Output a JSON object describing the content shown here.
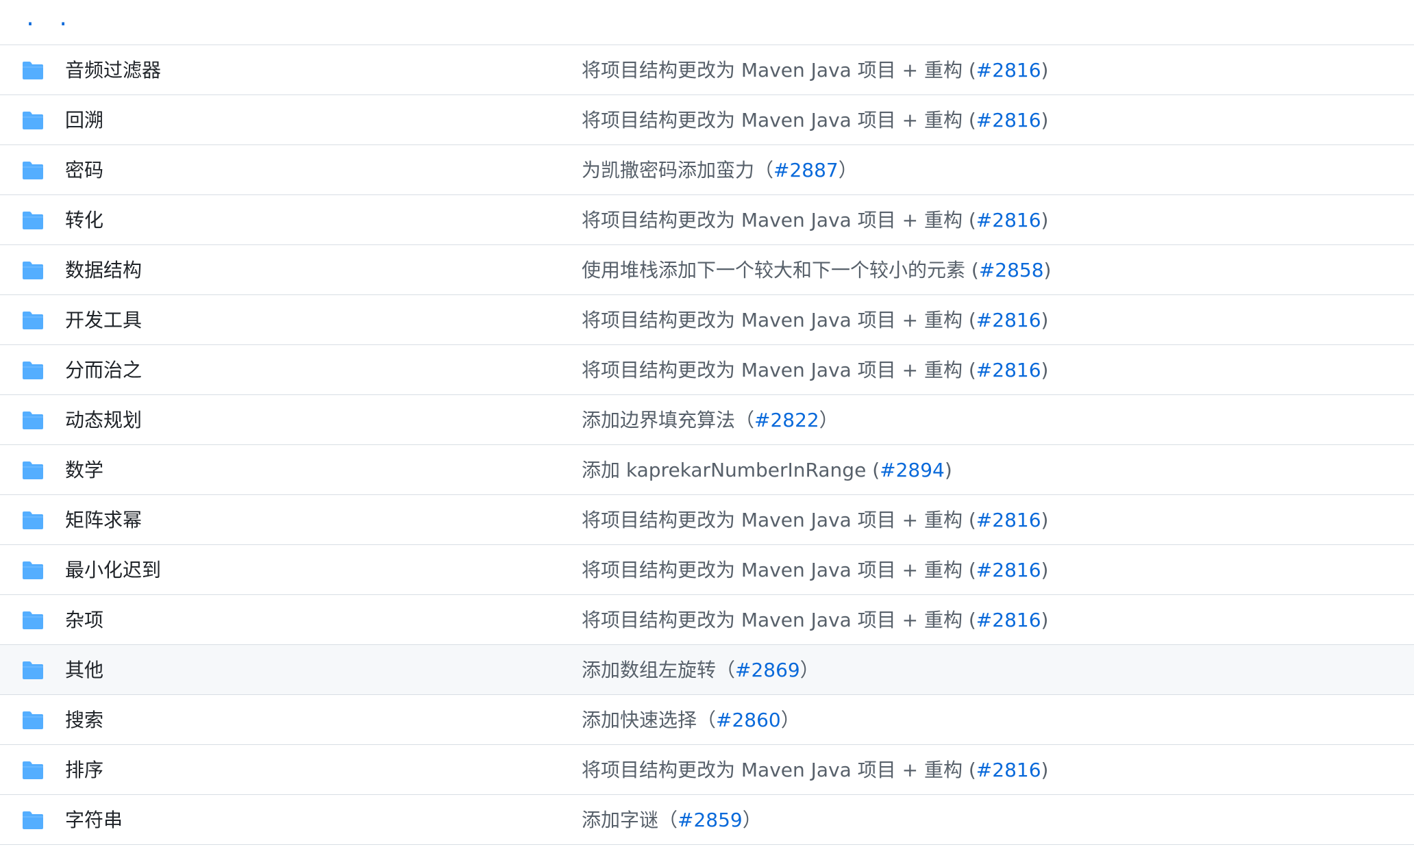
{
  "parent": {
    "label": ". ."
  },
  "colors": {
    "folder": "#54aeff",
    "link": "#0969da",
    "muted": "#57606a",
    "border": "#d8dee4",
    "hover_bg": "#f6f8fa"
  },
  "rows": [
    {
      "icon": "folder-icon",
      "name": "音频过滤器",
      "commit_text": "将项目结构更改为 Maven Java 项目 + 重构 (",
      "pr": "#2816",
      "commit_close": ")"
    },
    {
      "icon": "folder-icon",
      "name": "回溯",
      "commit_text": "将项目结构更改为 Maven Java 项目 + 重构 (",
      "pr": "#2816",
      "commit_close": ")"
    },
    {
      "icon": "folder-icon",
      "name": "密码",
      "commit_text": "为凯撒密码添加蛮力（",
      "pr": "#2887",
      "commit_close": "）"
    },
    {
      "icon": "folder-icon",
      "name": "转化",
      "commit_text": "将项目结构更改为 Maven Java 项目 + 重构 (",
      "pr": "#2816",
      "commit_close": ")"
    },
    {
      "icon": "folder-icon",
      "name": "数据结构",
      "commit_text": "使用堆栈添加下一个较大和下一个较小的元素 (",
      "pr": "#2858",
      "commit_close": ")"
    },
    {
      "icon": "folder-icon",
      "name": "开发工具",
      "commit_text": "将项目结构更改为 Maven Java 项目 + 重构 (",
      "pr": "#2816",
      "commit_close": ")"
    },
    {
      "icon": "folder-icon",
      "name": "分而治之",
      "commit_text": "将项目结构更改为 Maven Java 项目 + 重构 (",
      "pr": "#2816",
      "commit_close": ")"
    },
    {
      "icon": "folder-icon",
      "name": "动态规划",
      "commit_text": "添加边界填充算法（",
      "pr": "#2822",
      "commit_close": "）"
    },
    {
      "icon": "folder-icon",
      "name": "数学",
      "commit_text": "添加 kaprekarNumberInRange (",
      "pr": "#2894",
      "commit_close": ")"
    },
    {
      "icon": "folder-icon",
      "name": "矩阵求幂",
      "commit_text": "将项目结构更改为 Maven Java 项目 + 重构 (",
      "pr": "#2816",
      "commit_close": ")"
    },
    {
      "icon": "folder-icon",
      "name": "最小化迟到",
      "commit_text": "将项目结构更改为 Maven Java 项目 + 重构 (",
      "pr": "#2816",
      "commit_close": ")"
    },
    {
      "icon": "folder-icon",
      "name": "杂项",
      "commit_text": "将项目结构更改为 Maven Java 项目 + 重构 (",
      "pr": "#2816",
      "commit_close": ")"
    },
    {
      "icon": "folder-icon",
      "name": "其他",
      "commit_text": "添加数组左旋转（",
      "pr": "#2869",
      "commit_close": "）",
      "highlight": true
    },
    {
      "icon": "folder-icon",
      "name": "搜索",
      "commit_text": "添加快速选择（",
      "pr": "#2860",
      "commit_close": "）"
    },
    {
      "icon": "folder-icon",
      "name": "排序",
      "commit_text": "将项目结构更改为 Maven Java 项目 + 重构 (",
      "pr": "#2816",
      "commit_close": ")"
    },
    {
      "icon": "folder-icon",
      "name": "字符串",
      "commit_text": "添加字谜（",
      "pr": "#2859",
      "commit_close": "）"
    }
  ]
}
